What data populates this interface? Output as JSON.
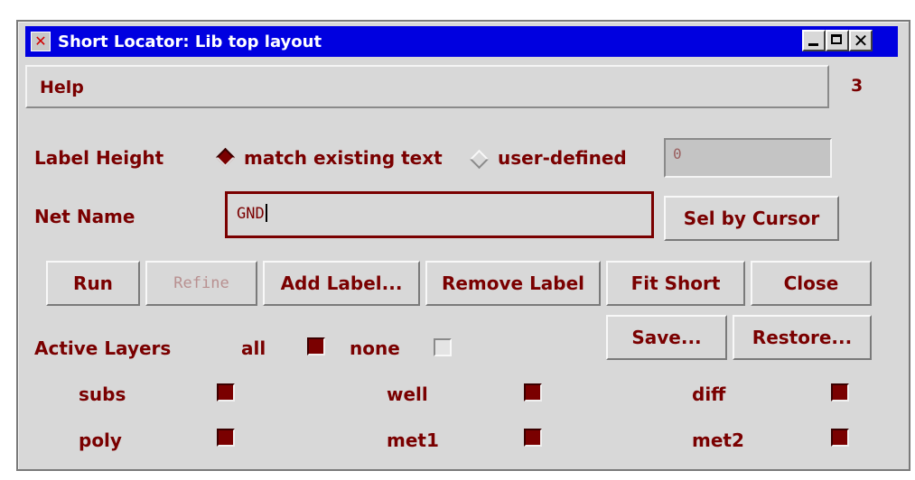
{
  "window": {
    "title": "Short Locator: Lib top layout",
    "icon": "x-app-icon",
    "controls": [
      "minimize",
      "maximize",
      "close"
    ]
  },
  "menubar": {
    "help_label": "Help",
    "counter": "3"
  },
  "label_height": {
    "label": "Label Height",
    "options": [
      {
        "label": "match existing text",
        "selected": true
      },
      {
        "label": "user-defined",
        "selected": false
      }
    ],
    "user_value": "0"
  },
  "net_name": {
    "label": "Net Name",
    "value": "GND",
    "sel_by_cursor_label": "Sel by Cursor"
  },
  "actions": {
    "run": "Run",
    "refine": "Refine",
    "add_label": "Add Label...",
    "remove_label": "Remove Label",
    "fit_short": "Fit Short",
    "close": "Close",
    "save": "Save...",
    "restore": "Restore..."
  },
  "active_layers": {
    "label": "Active Layers",
    "all_label": "all",
    "none_label": "none",
    "layers": [
      {
        "name": "subs",
        "checked": true
      },
      {
        "name": "well",
        "checked": true
      },
      {
        "name": "diff",
        "checked": true
      },
      {
        "name": "poly",
        "checked": true
      },
      {
        "name": "met1",
        "checked": true
      },
      {
        "name": "met2",
        "checked": true
      }
    ]
  },
  "colors": {
    "accent": "#7a0000",
    "titlebar": "#0000e0",
    "background": "#d8d8d8"
  }
}
